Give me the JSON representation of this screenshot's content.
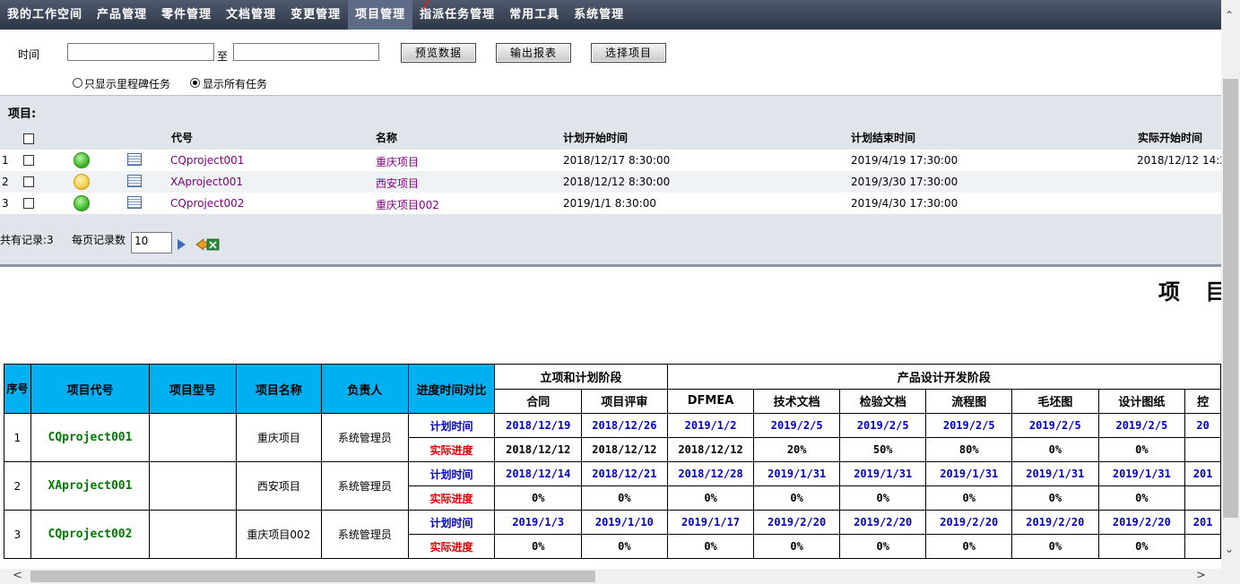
{
  "nav": {
    "items": [
      "我的工作空间",
      "产品管理",
      "零件管理",
      "文档管理",
      "变更管理",
      "项目管理",
      "指派任务管理",
      "常用工具",
      "系统管理"
    ],
    "active_index": 5
  },
  "filter": {
    "time_label": "时间",
    "to_label": "至",
    "start_value": "",
    "end_value": "",
    "preview_button": "预览数据",
    "export_button": "输出报表",
    "select_button": "选择项目",
    "radio_milestone": "只显示里程碑任务",
    "radio_all": "显示所有任务",
    "selected_radio": "all"
  },
  "project_list": {
    "title": "项目:",
    "columns": [
      "代号",
      "名称",
      "计划开始时间",
      "计划结束时间",
      "实际开始时间"
    ],
    "rows": [
      {
        "index": "1",
        "status": "green",
        "code": "CQproject001",
        "name": "重庆项目",
        "plan_start": "2018/12/17 8:30:00",
        "plan_end": "2019/4/19 17:30:00",
        "actual_start": "2018/12/12 14:2"
      },
      {
        "index": "2",
        "status": "yellow",
        "code": "XAproject001",
        "name": "西安项目",
        "plan_start": "2018/12/12 8:30:00",
        "plan_end": "2019/3/30 17:30:00",
        "actual_start": ""
      },
      {
        "index": "3",
        "status": "green",
        "code": "CQproject002",
        "name": "重庆项目002",
        "plan_start": "2019/1/1 8:30:00",
        "plan_end": "2019/4/30 17:30:00",
        "actual_start": ""
      }
    ],
    "total_label": "共有记录:3",
    "per_page_label": "每页记录数",
    "per_page_value": "10"
  },
  "report": {
    "title": "项 目",
    "headers": {
      "seq": "序号",
      "code": "项目代号",
      "model": "项目型号",
      "name": "项目名称",
      "owner": "负责人",
      "compare": "进度时间对比"
    },
    "stages": [
      {
        "label": "立项和计划阶段",
        "span": 2
      },
      {
        "label": "产品设计开发阶段",
        "span": 7
      }
    ],
    "sub_headers": [
      "合同",
      "项目评审",
      "DFMEA",
      "技术文档",
      "检验文档",
      "流程图",
      "毛坯图",
      "设计图纸",
      "控"
    ],
    "plan_label": "计划时间",
    "actual_label": "实际进度",
    "rows": [
      {
        "seq": "1",
        "code": "CQproject001",
        "model": "",
        "name": "重庆项目",
        "owner": "系统管理员",
        "plan": [
          "2018/12/19",
          "2018/12/26",
          "2019/1/2",
          "2019/2/5",
          "2019/2/5",
          "2019/2/5",
          "2019/2/5",
          "2019/2/5",
          "20"
        ],
        "actual": [
          "2018/12/12",
          "2018/12/12",
          "2018/12/12",
          "20%",
          "50%",
          "80%",
          "0%",
          "0%",
          ""
        ]
      },
      {
        "seq": "2",
        "code": "XAproject001",
        "model": "",
        "name": "西安项目",
        "owner": "系统管理员",
        "plan": [
          "2018/12/14",
          "2018/12/21",
          "2018/12/28",
          "2019/1/31",
          "2019/1/31",
          "2019/1/31",
          "2019/1/31",
          "2019/1/31",
          "201"
        ],
        "actual": [
          "0%",
          "0%",
          "0%",
          "0%",
          "0%",
          "0%",
          "0%",
          "0%",
          ""
        ]
      },
      {
        "seq": "3",
        "code": "CQproject002",
        "model": "",
        "name": "重庆项目002",
        "owner": "系统管理员",
        "plan": [
          "2019/1/3",
          "2019/1/10",
          "2019/1/17",
          "2019/2/20",
          "2019/2/20",
          "2019/2/20",
          "2019/2/20",
          "2019/2/20",
          "201"
        ],
        "actual": [
          "0%",
          "0%",
          "0%",
          "0%",
          "0%",
          "0%",
          "0%",
          "0%",
          ""
        ]
      }
    ]
  },
  "icons": {
    "status_green": "green-status-icon",
    "status_yellow": "yellow-status-icon",
    "detail": "detail-grid-icon",
    "go": "go-arrow-icon",
    "excel": "export-excel-icon"
  },
  "colors": {
    "nav_bg": "#3a4356",
    "header_cyan": "#00b0f0",
    "plan_blue": "#0000c8",
    "actual_red": "#e00000",
    "code_green": "#007a00"
  }
}
